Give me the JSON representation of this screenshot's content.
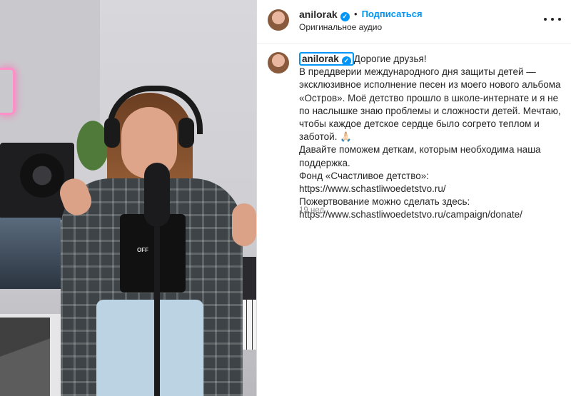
{
  "post": {
    "username": "anilorak",
    "follow_label": "Подписаться",
    "separator": "•",
    "audio_label": "Оригинальное аудио",
    "shirt_text": "OFF",
    "caption_lines": [
      "Дорогие друзья!",
      "В преддверии международного дня защиты детей —",
      "эксклюзивное исполнение песен из моего нового альбома",
      "«Остров». Моё детство прошло в школе-интернате и я не",
      "по наслышке знаю проблемы и сложности детей. Мечтаю,",
      "чтобы каждое детское сердце было согрето теплом и",
      "заботой. 🙏🏻",
      "Давайте поможем деткам, которым необходима наша",
      "поддержка.",
      "Фонд «Счастливое детство»:",
      "https://www.schastliwoedetstvo.ru/",
      "Пожертвование можно сделать здесь:",
      "https://www.schastliwoedetstvo.ru/campaign/donate/"
    ],
    "timestamp": "19 нед."
  },
  "icons": {
    "verified": "verified-badge-icon",
    "more": "more-options-icon"
  },
  "colors": {
    "accent": "#0095f6",
    "text": "#262626",
    "muted": "#8e8e8e"
  }
}
